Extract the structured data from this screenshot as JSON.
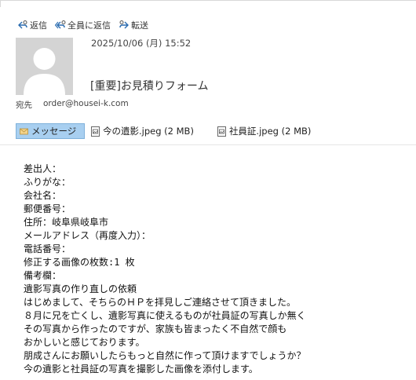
{
  "toolbar": {
    "reply_label": "返信",
    "reply_all_label": "全員に返信",
    "forward_label": "転送"
  },
  "message": {
    "date": "2025/10/06 (月) 15:52",
    "subject": "[重要]お見積りフォーム",
    "to_label": "宛先",
    "to_address": "order@housei-k.com"
  },
  "attachments": {
    "message_tab": "メッセージ",
    "files": [
      {
        "name": "今の遺影.jpeg (2 MB)"
      },
      {
        "name": "社員証.jpeg (2 MB)"
      }
    ]
  },
  "body_lines": [
    "差出人：",
    "ふりがな：",
    "会社名：",
    "郵便番号：",
    "住所：岐阜県岐阜市",
    "メールアドレス（再度入力）：",
    "電話番号：",
    "修正する画像の枚数:1 枚",
    "備考欄：",
    "遺影写真の作り直しの依頼",
    "はじめまして、そちらのＨＰを拝見しご連絡させて頂きました。",
    "８月に兄を亡くし、遺影写真に使えるものが社員証の写真しか無く",
    "その写真から作ったのですが、家族も皆まったく不自然で顔も",
    "おかしいと感じております。",
    "朋成さんにお願いしたらもっと自然に作って頂けますでしょうか？",
    "今の遺影と社員証の写真を撮影した画像を添付します。"
  ],
  "colors": {
    "accent": "#a8cff0",
    "accent_border": "#7fb1db",
    "avatar_bg": "#d4d4d4",
    "icon_blue": "#2b6cb0"
  },
  "icons": [
    "reply-icon",
    "reply-all-icon",
    "forward-icon",
    "avatar-person-icon",
    "envelope-icon",
    "image-file-icon"
  ]
}
